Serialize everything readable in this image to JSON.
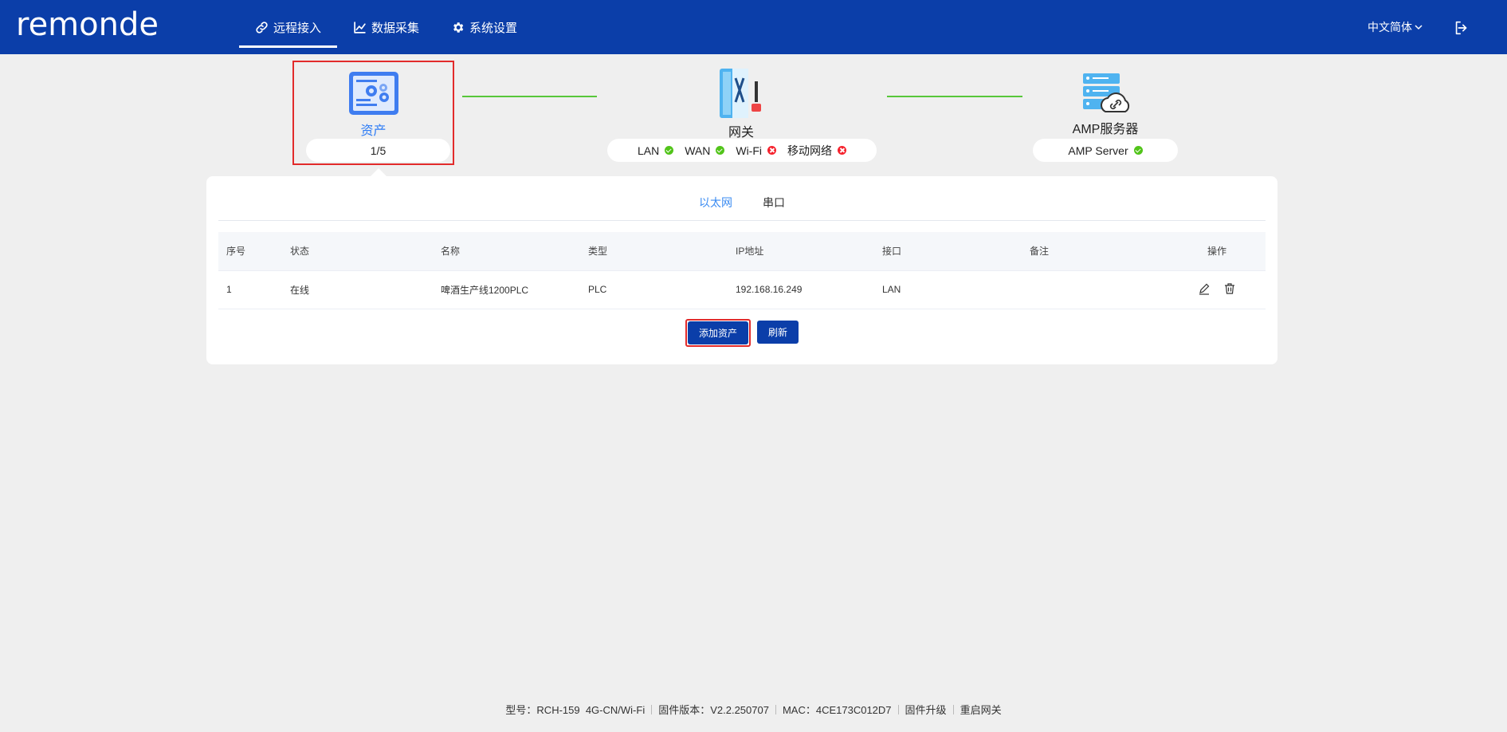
{
  "header": {
    "logo": "remonde",
    "nav": [
      {
        "label": "远程接入",
        "icon": "link-icon",
        "active": true
      },
      {
        "label": "数据采集",
        "icon": "chart-icon",
        "active": false
      },
      {
        "label": "系统设置",
        "icon": "gear-icon",
        "active": false
      }
    ],
    "language": "中文简体",
    "logout_icon": "logout-icon"
  },
  "topology": {
    "asset": {
      "label": "资产",
      "count": "1/5"
    },
    "gateway": {
      "label": "网关",
      "ports": [
        {
          "name": "LAN",
          "status": "ok"
        },
        {
          "name": "WAN",
          "status": "ok"
        },
        {
          "name": "Wi-Fi",
          "status": "error"
        },
        {
          "name": "移动网络",
          "status": "error"
        }
      ]
    },
    "server": {
      "label": "AMP服务器",
      "status_label": "AMP Server",
      "status": "ok"
    },
    "link_color": "#57c73a"
  },
  "tabs": [
    {
      "label": "以太网",
      "active": true
    },
    {
      "label": "串口",
      "active": false
    }
  ],
  "table": {
    "headers": [
      "序号",
      "状态",
      "名称",
      "类型",
      "IP地址",
      "接口",
      "备注",
      "操作"
    ],
    "rows": [
      {
        "index": "1",
        "status": "在线",
        "name": "啤酒生产线1200PLC",
        "type": "PLC",
        "ip": "192.168.16.249",
        "port": "LAN",
        "note": ""
      }
    ]
  },
  "buttons": {
    "add": "添加资产",
    "refresh": "刷新"
  },
  "footer": {
    "model": "型号：RCH-159  4G-CN/Wi-Fi",
    "firmware": "固件版本：V2.2.250707",
    "mac": "MAC：4CE173C012D7",
    "upgrade": "固件升级",
    "reboot": "重启网关"
  },
  "colors": {
    "brand": "#0b3ea9",
    "ok": "#52c41a",
    "error": "#f5222d",
    "highlight": "#e22b2b",
    "accent": "#3c8cf2"
  }
}
